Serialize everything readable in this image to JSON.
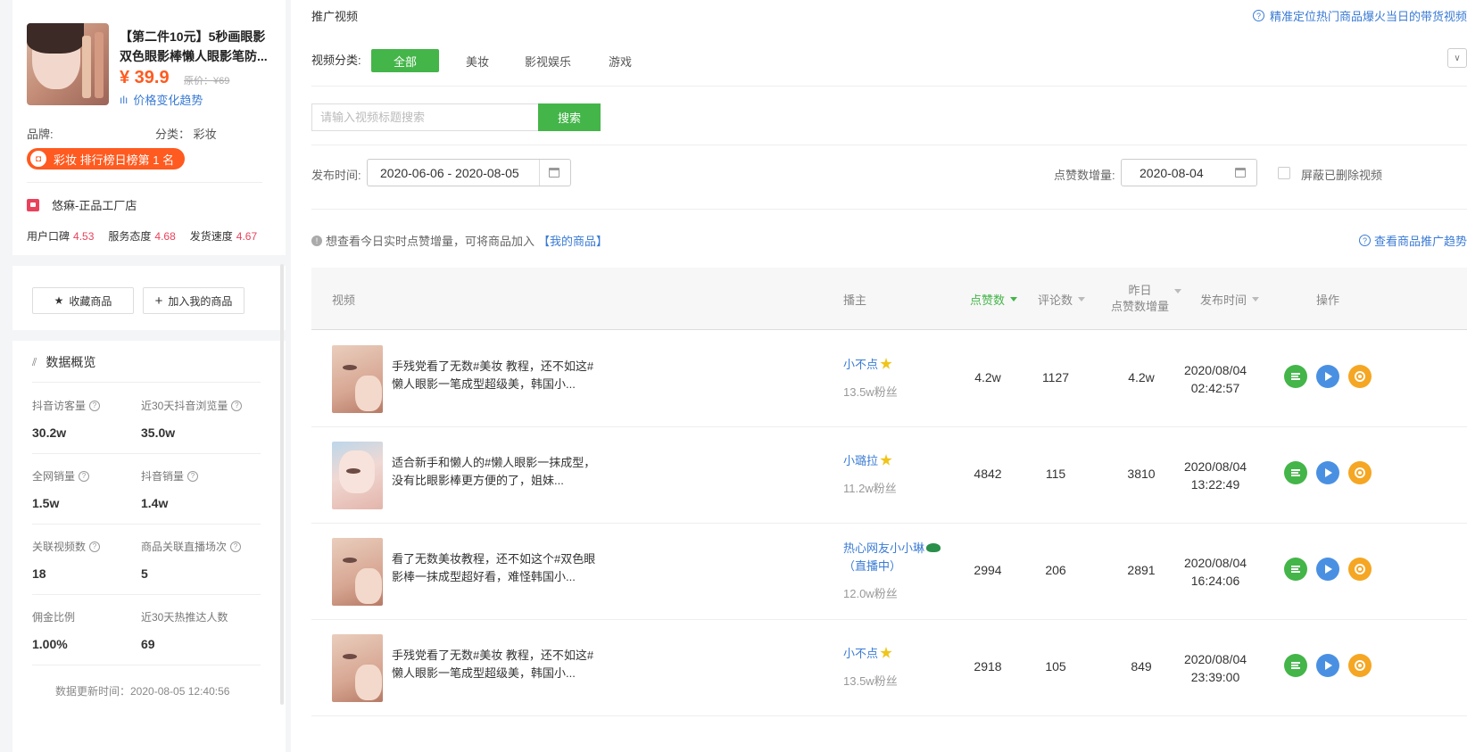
{
  "product": {
    "title": "【第二件10元】5秒画眼影双色眼影棒懒人眼影笔防...",
    "price": "¥ 39.9",
    "original_price": "原价：¥69",
    "price_trend_link": "价格变化趋势",
    "brand_label": "品牌:",
    "category": "分类： 彩妆",
    "rank_badge": "彩妆 排行榜日榜第 1 名"
  },
  "shop": {
    "name": "悠痳-正品工厂店",
    "scores": [
      {
        "label": "用户口碑",
        "value": "4.53"
      },
      {
        "label": "服务态度",
        "value": "4.68"
      },
      {
        "label": "发货速度",
        "value": "4.67"
      }
    ]
  },
  "actions": {
    "favorite": "收藏商品",
    "add_mine": "加入我的商品"
  },
  "overview": {
    "title": "数据概览",
    "stats": [
      {
        "label": "抖音访客量",
        "value": "30.2w",
        "help": true
      },
      {
        "label": "近30天抖音浏览量",
        "value": "35.0w",
        "help": true
      },
      {
        "label": "全网销量",
        "value": "1.5w",
        "help": true
      },
      {
        "label": "抖音销量",
        "value": "1.4w",
        "help": true
      },
      {
        "label": "关联视频数",
        "value": "18",
        "help": true
      },
      {
        "label": "商品关联直播场次",
        "value": "5",
        "help": true
      },
      {
        "label": "佣金比例",
        "value": "1.00%",
        "help": false
      },
      {
        "label": "近30天热推达人数",
        "value": "69",
        "help": false
      }
    ],
    "update_time": "数据更新时间：2020-08-05 12:40:56"
  },
  "main": {
    "section_title": "推广视频",
    "top_link": "精准定位热门商品爆火当日的带货视频",
    "category_label": "视频分类:",
    "categories": [
      "全部",
      "美妆",
      "影视娱乐",
      "游戏"
    ],
    "search_placeholder": "请输入视频标题搜索",
    "search_button": "搜索",
    "publish_label": "发布时间:",
    "publish_range": "2020-06-06 - 2020-08-05",
    "likes_inc_label": "点赞数增量:",
    "likes_inc_date": "2020-08-04",
    "hide_deleted": "屏蔽已删除视频",
    "info_text": "想查看今日实时点赞增量，可将商品加入",
    "info_link": "【我的商品】",
    "trend_link": "查看商品推广趋势"
  },
  "table": {
    "headers": {
      "video": "视频",
      "anchor": "播主",
      "likes": "点赞数",
      "comments": "评论数",
      "yesterday_1": "昨日",
      "yesterday_2": "点赞数增量",
      "publish": "发布时间",
      "ops": "操作"
    },
    "rows": [
      {
        "title": "手残党看了无数#美妆 教程，还不如这#懒人眼影一笔成型超级美，韩国小...",
        "anchor": "小不点",
        "anchor_extra": "",
        "fans": "13.5w粉丝",
        "likes": "4.2w",
        "comments": "1127",
        "yesterday": "4.2w",
        "date": "2020/08/04",
        "time": "02:42:57"
      },
      {
        "title": "适合新手和懒人的#懒人眼影一抹成型，没有比眼影棒更方便的了，姐妹...",
        "anchor": "小璐拉",
        "anchor_extra": "",
        "fans": "11.2w粉丝",
        "likes": "4842",
        "comments": "115",
        "yesterday": "3810",
        "date": "2020/08/04",
        "time": "13:22:49"
      },
      {
        "title": "看了无数美妆教程，还不如这个#双色眼影棒一抹成型超好看，难怪韩国小...",
        "anchor": "热心网友小小琳",
        "anchor_extra": "（直播中）",
        "fans": "12.0w粉丝",
        "likes": "2994",
        "comments": "206",
        "yesterday": "2891",
        "date": "2020/08/04",
        "time": "16:24:06"
      },
      {
        "title": "手残党看了无数#美妆 教程，还不如这#懒人眼影一笔成型超级美，韩国小...",
        "anchor": "小不点",
        "anchor_extra": "",
        "fans": "13.5w粉丝",
        "likes": "2918",
        "comments": "105",
        "yesterday": "849",
        "date": "2020/08/04",
        "time": "23:39:00"
      }
    ]
  },
  "colors": {
    "accent_green": "#44b549",
    "link_blue": "#3a7bd5",
    "price_orange": "#ff5a1f",
    "score_red": "#e9425b"
  },
  "icons": [
    "price-trend-icon",
    "bag-icon",
    "store-icon",
    "star-icon",
    "plus-icon",
    "chart-icon",
    "help-icon",
    "calendar-icon",
    "info-icon",
    "detail-icon",
    "play-icon",
    "target-icon",
    "chevron-down-icon"
  ]
}
